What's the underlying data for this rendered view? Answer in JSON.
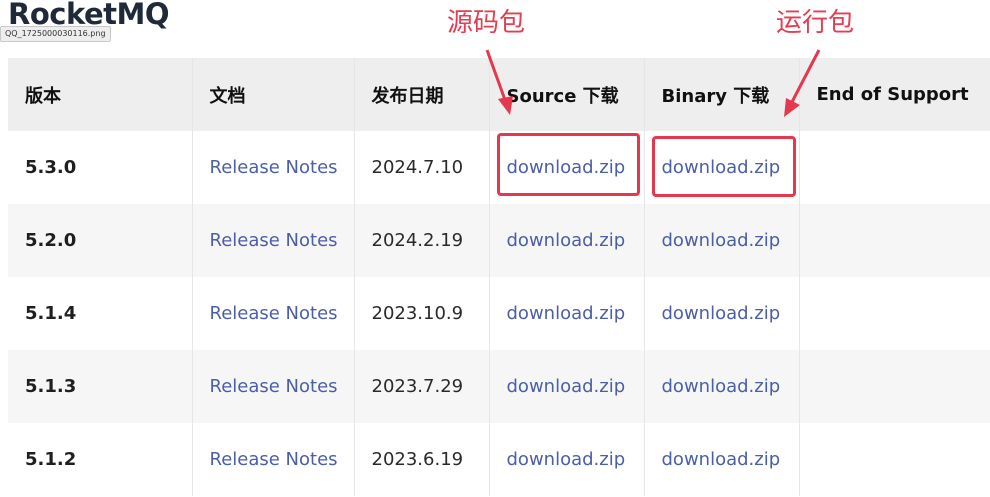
{
  "brand": "RocketMQ",
  "file_tag": "QQ_1725000030116.png",
  "annotations": {
    "source": {
      "label": "源码包",
      "color": "#e5384f"
    },
    "binary": {
      "label": "运行包",
      "color": "#e5384f"
    }
  },
  "table": {
    "headers": {
      "version": "版本",
      "docs": "文档",
      "date": "发布日期",
      "source": "Source 下载",
      "binary": "Binary 下载",
      "eos": "End of Support"
    },
    "rows": [
      {
        "version": "5.3.0",
        "docs": "Release Notes",
        "date": "2024.7.10",
        "source": "download.zip",
        "binary": "download.zip",
        "eos": ""
      },
      {
        "version": "5.2.0",
        "docs": "Release Notes",
        "date": "2024.2.19",
        "source": "download.zip",
        "binary": "download.zip",
        "eos": ""
      },
      {
        "version": "5.1.4",
        "docs": "Release Notes",
        "date": "2023.10.9",
        "source": "download.zip",
        "binary": "download.zip",
        "eos": ""
      },
      {
        "version": "5.1.3",
        "docs": "Release Notes",
        "date": "2023.7.29",
        "source": "download.zip",
        "binary": "download.zip",
        "eos": ""
      },
      {
        "version": "5.1.2",
        "docs": "Release Notes",
        "date": "2023.6.19",
        "source": "download.zip",
        "binary": "download.zip",
        "eos": ""
      }
    ]
  },
  "colors": {
    "link": "#4b5ea8",
    "header_bg": "#eeeeee",
    "row_alt_bg": "#f6f6f6",
    "annotation": "#e5384f"
  }
}
